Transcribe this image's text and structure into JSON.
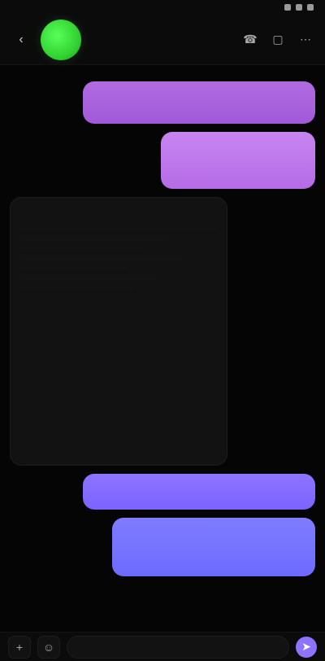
{
  "status_bar": {
    "time": "",
    "battery": "",
    "signal": ""
  },
  "header": {
    "contact_name": "",
    "contact_sub": "",
    "icons": [
      "back-icon",
      "phone-icon",
      "video-icon",
      "more-icon"
    ]
  },
  "chat": {
    "sys_top": "",
    "bubble_out_1": "",
    "bubble_out_2": "",
    "incoming_1_accent": "",
    "incoming_1_text": "",
    "bubble_out_3": "",
    "sys_mid": "",
    "bubble_out_4": ""
  },
  "composer": {
    "placeholder": "",
    "left_icons": [
      "plus-icon",
      "emoji-icon"
    ],
    "send_icon": "send-icon"
  },
  "colors": {
    "avatar": "#2fcf2f",
    "bubble_violet": "#b06be0",
    "bubble_purple": "#7b63ff",
    "bubble_blue": "#6d6bff",
    "accent_pink": "#ff5aa6"
  }
}
